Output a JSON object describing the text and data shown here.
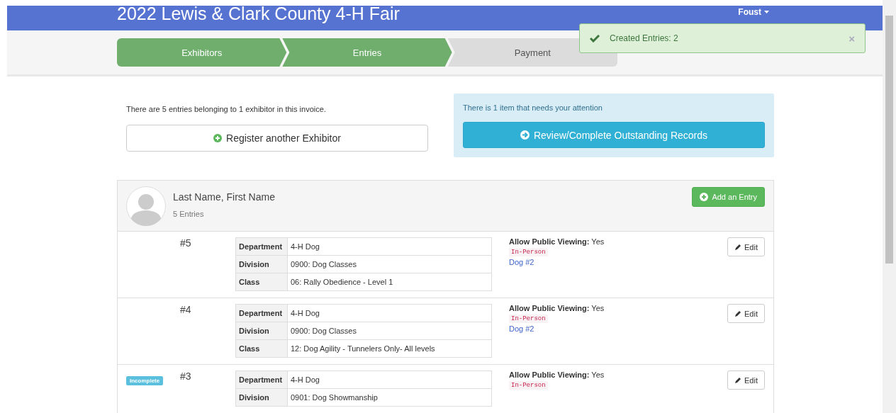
{
  "header": {
    "title": "2022 Lewis & Clark County 4-H Fair",
    "user": "Foust"
  },
  "steps": [
    {
      "label": "Exhibitors",
      "complete": true
    },
    {
      "label": "Entries",
      "complete": true
    },
    {
      "label": "Payment",
      "complete": false
    }
  ],
  "toast": {
    "message": "Created Entries: 2",
    "close": "×"
  },
  "summary": {
    "text": "There are 5 entries belonging to 1 exhibitor in this invoice.",
    "button": "Register another Exhibitor"
  },
  "attention": {
    "text": "There is 1 item that needs your attention",
    "button": "Review/Complete Outstanding Records"
  },
  "exhibitor": {
    "name": "Last Name, First Name",
    "count": "5 Entries",
    "add_button": "Add an Entry"
  },
  "entries": [
    {
      "number": "#5",
      "fields": [
        {
          "label": "Department",
          "value": "4-H Dog"
        },
        {
          "label": "Division",
          "value": "0900: Dog Classes"
        },
        {
          "label": "Class",
          "value": "06: Rally Obedience - Level 1"
        }
      ],
      "viewing_label": "Allow Public Viewing:",
      "viewing_value": "Yes",
      "tag": "In-Person",
      "link": "Dog #2",
      "edit": "Edit"
    },
    {
      "number": "#4",
      "fields": [
        {
          "label": "Department",
          "value": "4-H Dog"
        },
        {
          "label": "Division",
          "value": "0900: Dog Classes"
        },
        {
          "label": "Class",
          "value": "12: Dog Agility - Tunnelers Only- All levels"
        }
      ],
      "viewing_label": "Allow Public Viewing:",
      "viewing_value": "Yes",
      "tag": "In-Person",
      "link": "Dog #2",
      "edit": "Edit"
    },
    {
      "number": "#3",
      "badge": "Incomplete",
      "fields": [
        {
          "label": "Department",
          "value": "4-H Dog"
        },
        {
          "label": "Division",
          "value": "0901: Dog Showmanship"
        }
      ],
      "viewing_label": "Allow Public Viewing:",
      "viewing_value": "Yes",
      "tag": "In-Person",
      "edit": "Edit"
    }
  ]
}
